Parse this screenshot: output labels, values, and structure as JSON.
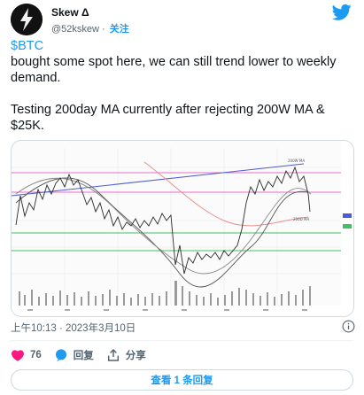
{
  "author": {
    "name": "Skew Δ",
    "handle": "@52kskew",
    "separator": "·",
    "follow_label": "关注"
  },
  "tweet": {
    "cashtag": "$BTC",
    "line1": "bought some spot here, we can still trend lower to weekly demand.",
    "line2": "Testing 200day MA currently after rejecting 200W MA & $25K."
  },
  "meta": {
    "timestamp": "上午10:13 · 2023年3月10日"
  },
  "actions": {
    "likes": "76",
    "reply_label": "回复",
    "share_label": "分享"
  },
  "replies_button": "查看 1 条回复",
  "colors": {
    "accent": "#1d9bf0",
    "like": "#f91880",
    "text": "#0f1419",
    "muted": "#536471"
  }
}
